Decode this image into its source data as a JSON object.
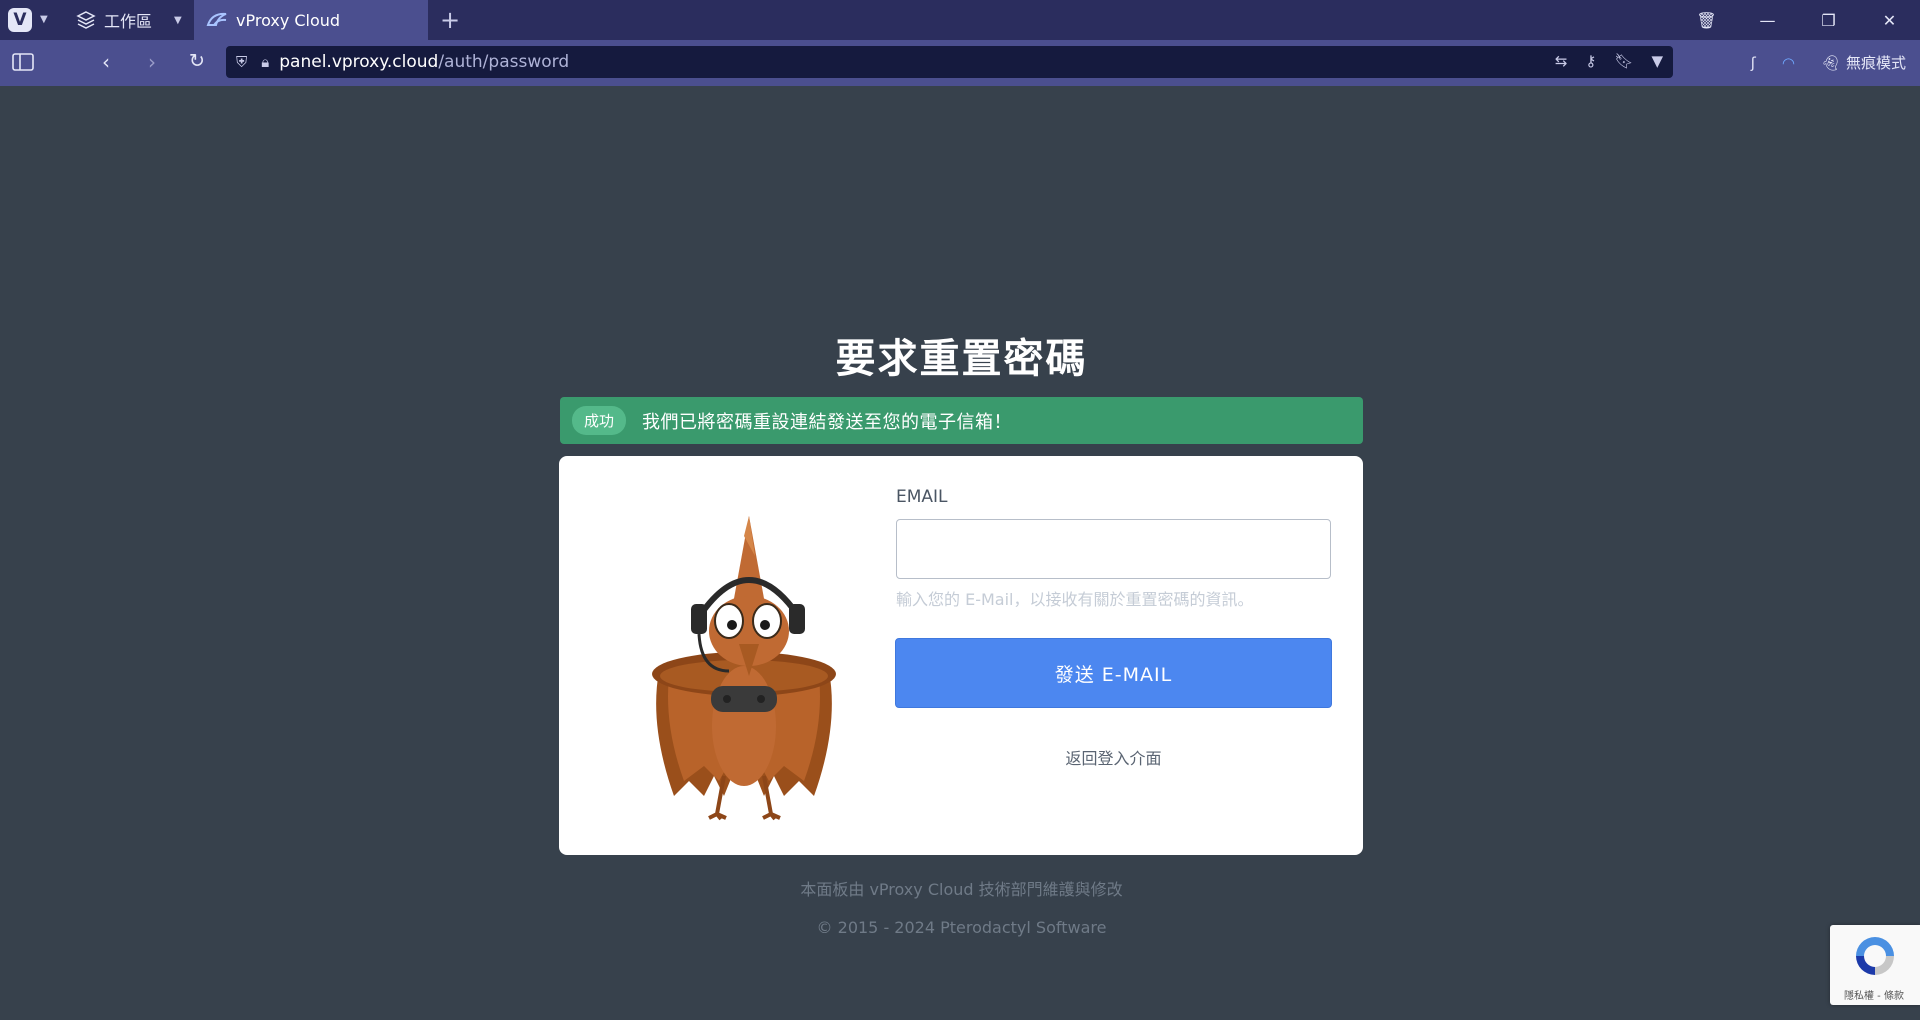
{
  "browser": {
    "workspace_label": "工作區",
    "tab_title": "vProxy Cloud",
    "url_host": "panel.vproxy.cloud",
    "url_path": "/auth/password",
    "private_label": "無痕模式"
  },
  "page": {
    "title": "要求重置密碼",
    "alert": {
      "badge": "成功",
      "message": "我們已將密碼重設連結發送至您的電子信箱！"
    },
    "form": {
      "email_label": "EMAIL",
      "email_value": "",
      "email_hint": "輸入您的 E-Mail，以接收有關於重置密碼的資訊。",
      "send_button": "發送 E-MAIL",
      "back_link": "返回登入介面"
    },
    "footer": {
      "maintainer": "本面板由 vProxy Cloud 技術部門維護與修改",
      "copyright": "© 2015 - 2024 Pterodactyl Software"
    },
    "recaptcha_text": "隱私權 - 條款"
  },
  "colors": {
    "page_bg": "#37414c",
    "success": "#3a9a6d",
    "primary_button": "#4c87f0",
    "tab_bar": "#2b2d5e",
    "address_bar": "#4b4f8f"
  }
}
